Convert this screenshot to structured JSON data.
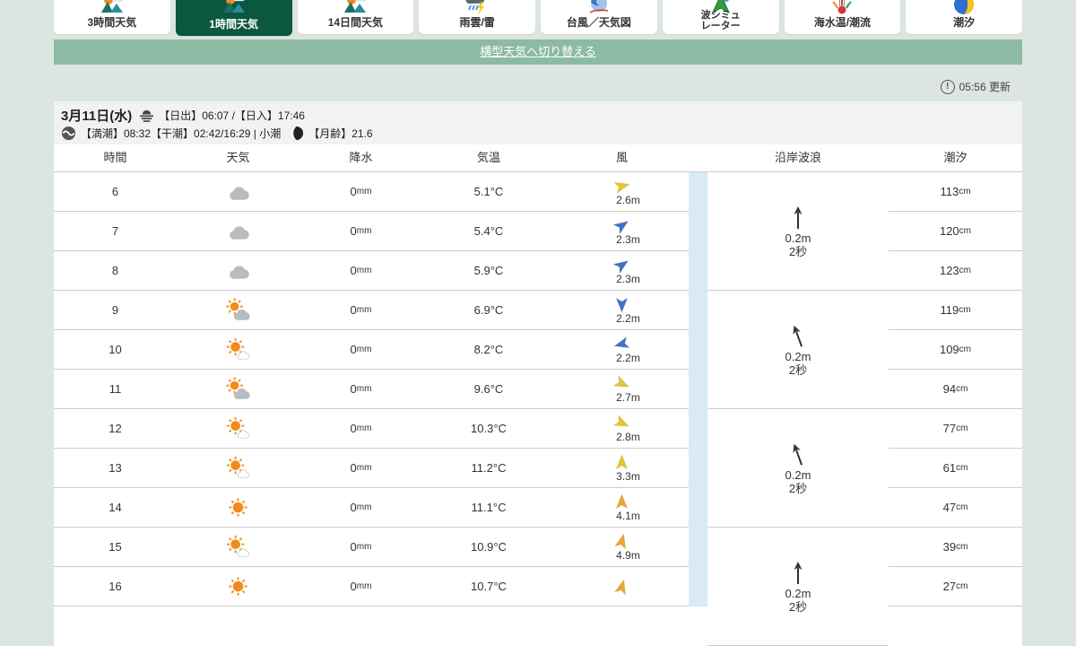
{
  "page": {
    "bg": "#dce5e0",
    "selected_tab_green": "#0b5740",
    "banner_green": "#8cbaa4",
    "strip_blue": "#daeaf5"
  },
  "tabs": [
    {
      "label": "3時間天気",
      "icon": "weather-scene-icon",
      "selected": false
    },
    {
      "label": "1時間天気",
      "icon": "weather-scene-icon",
      "selected": true
    },
    {
      "label": "14日間天気",
      "icon": "weather-scene-icon",
      "selected": false
    },
    {
      "label": "雨雲/雷",
      "icon": "rain-thunder-icon",
      "selected": false
    },
    {
      "label": "台風／天気図",
      "icon": "typhoon-icon",
      "selected": false
    },
    {
      "label": "波シミュ\nレーター",
      "icon": "wave-sim-icon",
      "selected": false
    },
    {
      "label": "海水温/潮流",
      "icon": "sea-temp-icon",
      "selected": false
    },
    {
      "label": "潮汐",
      "icon": "tide-moon-icon",
      "selected": false
    }
  ],
  "banner": {
    "link_label": "横型天気へ切り替える"
  },
  "status": {
    "updated": "05:56 更新"
  },
  "date_header": {
    "date": "3月11日(水)",
    "sun_times": "【日出】06:07 /【日入】17:46",
    "tide_times": "【満潮】08:32【干潮】02:42/16:29 | 小潮",
    "moon_age": "【月齢】21.6"
  },
  "table": {
    "columns": [
      "時間",
      "天気",
      "降水",
      "気温",
      "風",
      "沿岸波浪",
      "潮汐"
    ],
    "wind_colors": {
      "weak": "#3a74c9",
      "mid": "#e3c630",
      "strong": "#f0a437"
    },
    "rows": [
      {
        "hour": "6",
        "weather": "cloudy",
        "precip": "0",
        "precip_unit": "mm",
        "temp": "5.1°C",
        "wind": {
          "speed": "2.6m",
          "level": "mid",
          "deg": 75
        },
        "tide": "113",
        "tide_unit": "cm"
      },
      {
        "hour": "7",
        "weather": "cloudy",
        "precip": "0",
        "precip_unit": "mm",
        "temp": "5.4°C",
        "wind": {
          "speed": "2.3m",
          "level": "weak",
          "deg": 55
        },
        "tide": "120",
        "tide_unit": "cm"
      },
      {
        "hour": "8",
        "weather": "cloudy",
        "precip": "0",
        "precip_unit": "mm",
        "temp": "5.9°C",
        "wind": {
          "speed": "2.3m",
          "level": "weak",
          "deg": 55
        },
        "tide": "123",
        "tide_unit": "cm"
      },
      {
        "hour": "9",
        "weather": "sun-cloud",
        "precip": "0",
        "precip_unit": "mm",
        "temp": "6.9°C",
        "wind": {
          "speed": "2.2m",
          "level": "weak",
          "deg": 180
        },
        "tide": "119",
        "tide_unit": "cm"
      },
      {
        "hour": "10",
        "weather": "mostly-sunny",
        "precip": "0",
        "precip_unit": "mm",
        "temp": "8.2°C",
        "wind": {
          "speed": "2.2m",
          "level": "weak",
          "deg": 255
        },
        "tide": "109",
        "tide_unit": "cm"
      },
      {
        "hour": "11",
        "weather": "sun-cloud",
        "precip": "0",
        "precip_unit": "mm",
        "temp": "9.6°C",
        "wind": {
          "speed": "2.7m",
          "level": "mid",
          "deg": 115
        },
        "tide": "94",
        "tide_unit": "cm"
      },
      {
        "hour": "12",
        "weather": "mostly-sunny",
        "precip": "0",
        "precip_unit": "mm",
        "temp": "10.3°C",
        "wind": {
          "speed": "2.8m",
          "level": "mid",
          "deg": 115
        },
        "tide": "77",
        "tide_unit": "cm"
      },
      {
        "hour": "13",
        "weather": "mostly-sunny",
        "precip": "0",
        "precip_unit": "mm",
        "temp": "11.2°C",
        "wind": {
          "speed": "3.3m",
          "level": "mid",
          "deg": 0
        },
        "tide": "61",
        "tide_unit": "cm"
      },
      {
        "hour": "14",
        "weather": "sunny",
        "precip": "0",
        "precip_unit": "mm",
        "temp": "11.1°C",
        "wind": {
          "speed": "4.1m",
          "level": "strong",
          "deg": 0
        },
        "tide": "47",
        "tide_unit": "cm"
      },
      {
        "hour": "15",
        "weather": "mostly-sunny",
        "precip": "0",
        "precip_unit": "mm",
        "temp": "10.9°C",
        "wind": {
          "speed": "4.9m",
          "level": "strong",
          "deg": 15
        },
        "tide": "39",
        "tide_unit": "cm"
      },
      {
        "hour": "16",
        "weather": "sunny",
        "precip": "0",
        "precip_unit": "mm",
        "temp": "10.7°C",
        "wind": {
          "speed": "",
          "level": "strong",
          "deg": 15
        },
        "tide": "27",
        "tide_unit": "cm"
      }
    ],
    "wave_groups": [
      {
        "hours": "6-8",
        "height": "0.2m",
        "period": "2秒",
        "deg": 0,
        "start": 1,
        "span": 3
      },
      {
        "hours": "9-11",
        "height": "0.2m",
        "period": "2秒",
        "deg": -20,
        "start": 4,
        "span": 3
      },
      {
        "hours": "12-14",
        "height": "0.2m",
        "period": "2秒",
        "deg": -20,
        "start": 7,
        "span": 3
      },
      {
        "hours": "15-17",
        "height": "0.2m",
        "period": "2秒",
        "deg": 0,
        "start": 10,
        "span": 3
      }
    ]
  }
}
